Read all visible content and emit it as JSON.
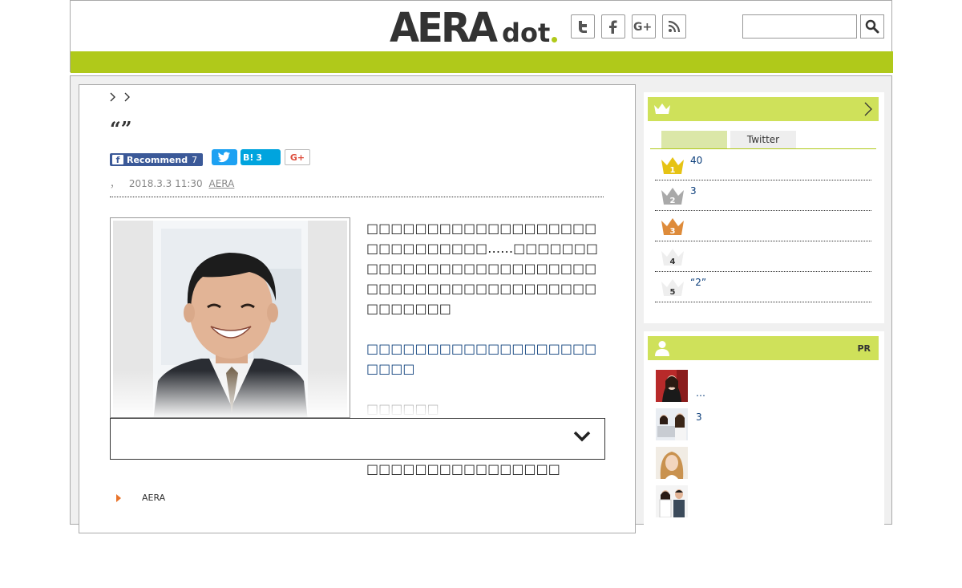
{
  "header": {
    "logo_main": "AERA",
    "logo_sub": "dot",
    "social": [
      "twitter-icon",
      "facebook-icon",
      "google-plus-icon",
      "rss-icon"
    ],
    "search": {
      "placeholder": "",
      "value": ""
    },
    "accent_color": "#b0c91a"
  },
  "article": {
    "title": "“”",
    "share": {
      "facebook_label": "Recommend",
      "facebook_count": "7",
      "hatena_label": "B!",
      "hatena_count": "3",
      "googleplus_label": "G+"
    },
    "meta": {
      "prefix": "，",
      "date": "2018.3.3 11:30",
      "source": "AERA"
    },
    "paragraphs": [
      "□□□□□□□□□□□□□□□□□□□□□□□□□□□□□……□□□□□□□□□□□□□□□□□□□□□□□□□□□□□□□□□□□□□□□□□□□□□□□□□□□□",
      "□□□□□□□□□□□□□□□□□□□□□□□",
      "□□□□□□\n□□□□□□□□□□□□□□□□□□□□□□□□□□□30□□□□□□□□□□□□□□□□□□□□□□□□□□"
    ],
    "source_link": "AERA"
  },
  "sidebar": {
    "ranking": {
      "tabs": [
        "",
        "Twitter"
      ],
      "items": [
        {
          "rank": "1",
          "text": "40"
        },
        {
          "rank": "2",
          "text": "3"
        },
        {
          "rank": "3",
          "text": ""
        },
        {
          "rank": "4",
          "text": ""
        },
        {
          "rank": "5",
          "text": "“2”"
        }
      ]
    },
    "pr": {
      "label": "PR",
      "items": [
        {
          "text": "…"
        },
        {
          "text": "3"
        },
        {
          "text": ""
        },
        {
          "text": ""
        }
      ]
    }
  }
}
